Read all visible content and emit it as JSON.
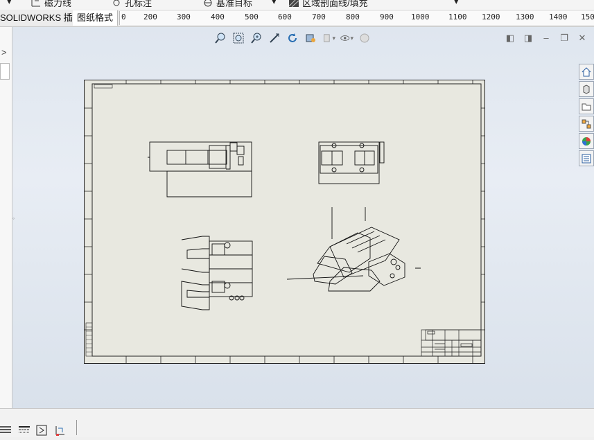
{
  "toolbar": {
    "items": [
      {
        "label": "磁力线",
        "icon": "magnetic-line-icon"
      },
      {
        "label": "孔标注",
        "icon": "hole-callout-icon"
      },
      {
        "label": "基准目标",
        "icon": "datum-target-icon"
      },
      {
        "label": "区域剖面线/填充",
        "icon": "area-hatch-icon"
      }
    ]
  },
  "tabs": [
    {
      "label": "SOLIDWORKS 插件"
    },
    {
      "label": "图纸格式"
    }
  ],
  "ruler": {
    "ticks": [
      "0",
      "200",
      "300",
      "400",
      "500",
      "600",
      "700",
      "800",
      "900",
      "1000",
      "1100",
      "1200",
      "1300",
      "1400",
      "150"
    ]
  },
  "view_toolbar": {
    "icons": [
      "zoom-to-fit-icon",
      "zoom-to-area-icon",
      "zoom-in-out-icon",
      "pan-icon",
      "rotate-icon",
      "display-style-icon",
      "section-view-icon",
      "hide-show-icon",
      "appearance-icon"
    ]
  },
  "window_controls": {
    "icons": [
      "tile-left-icon",
      "tile-right-icon",
      "minimize-icon",
      "restore-icon",
      "close-icon"
    ]
  },
  "task_pane": {
    "icons": [
      "home-icon",
      "design-library-icon",
      "file-explorer-icon",
      "view-palette-icon",
      "appearances-icon",
      "custom-properties-icon"
    ]
  },
  "bottom_bar": {
    "icons": [
      "layer-icon",
      "line-style-icon",
      "line-format-icon",
      "drawing-tools-icon"
    ]
  }
}
